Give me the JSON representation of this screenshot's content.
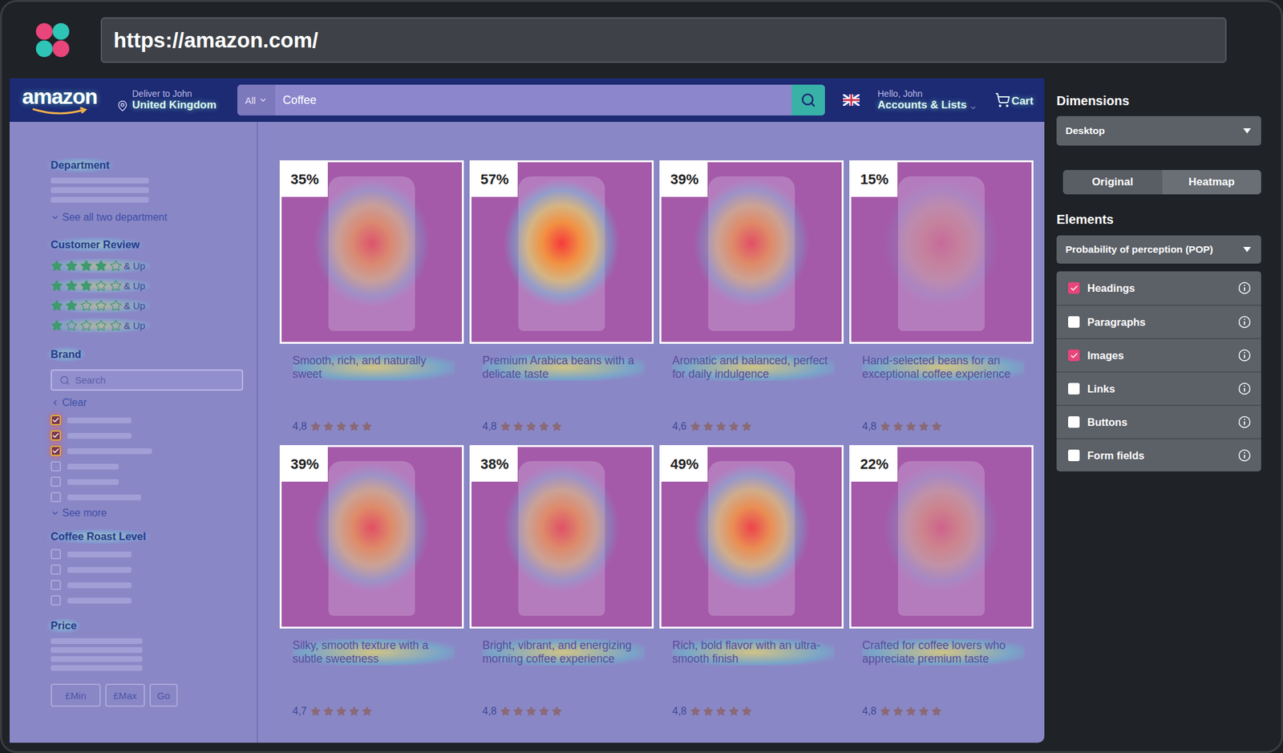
{
  "app": {
    "url": "https://amazon.com/"
  },
  "store": {
    "logo": "amazon",
    "deliver_label": "Deliver to John",
    "deliver_location": "United Kingdom",
    "search_category": "All",
    "search_value": "Coffee",
    "greeting": "Hello, John",
    "account": "Accounts & Lists",
    "cart": "Cart"
  },
  "filters": {
    "department_title": "Department",
    "see_all": "See all two department",
    "review_title": "Customer Review",
    "reviews": [
      {
        "stars": 4,
        "label": "& Up"
      },
      {
        "stars": 3,
        "label": "& Up"
      },
      {
        "stars": 2,
        "label": "& Up"
      },
      {
        "stars": 1,
        "label": "& Up"
      }
    ],
    "brand_title": "Brand",
    "brand_search_placeholder": "Search",
    "clear": "Clear",
    "brand_items": [
      {
        "checked": true
      },
      {
        "checked": true
      },
      {
        "checked": true
      },
      {
        "checked": false
      },
      {
        "checked": false
      },
      {
        "checked": false
      }
    ],
    "see_more": "See more",
    "roast_title": "Coffee Roast Level",
    "roast_items": [
      {
        "checked": false
      },
      {
        "checked": false
      },
      {
        "checked": false
      },
      {
        "checked": false
      }
    ],
    "price_title": "Price",
    "min": "£Min",
    "max": "£Max",
    "go": "Go"
  },
  "products": [
    {
      "pop": "35%",
      "description": "Smooth, rich, and naturally sweet",
      "rating": "4,8",
      "stars": 5
    },
    {
      "pop": "57%",
      "description": "Premium Arabica beans with a delicate taste",
      "rating": "4,8",
      "stars": 5
    },
    {
      "pop": "39%",
      "description": "Aromatic and balanced, perfect for daily indulgence",
      "rating": "4,6",
      "stars": 5
    },
    {
      "pop": "15%",
      "description": "Hand-selected beans for an exceptional coffee experience",
      "rating": "4,8",
      "stars": 5
    },
    {
      "pop": "39%",
      "description": "Silky, smooth texture with a subtle sweetness",
      "rating": "4,7",
      "stars": 5
    },
    {
      "pop": "38%",
      "description": "Bright, vibrant, and energizing morning coffee experience",
      "rating": "4,8",
      "stars": 5
    },
    {
      "pop": "49%",
      "description": "Rich, bold flavor with an ultra-smooth finish",
      "rating": "4,8",
      "stars": 5
    },
    {
      "pop": "22%",
      "description": "Crafted for coffee lovers who appreciate premium taste",
      "rating": "4,8",
      "stars": 5
    }
  ],
  "panel": {
    "dimensions_title": "Dimensions",
    "dimension": "Desktop",
    "views": [
      {
        "label": "Original",
        "selected": false
      },
      {
        "label": "Heatmap",
        "selected": true
      }
    ],
    "elements_title": "Elements",
    "metric": "Probability of perception (POP)",
    "elements": [
      {
        "label": "Headings",
        "checked": true
      },
      {
        "label": "Paragraphs",
        "checked": false
      },
      {
        "label": "Images",
        "checked": true
      },
      {
        "label": "Links",
        "checked": false
      },
      {
        "label": "Buttons",
        "checked": false
      },
      {
        "label": "Form fields",
        "checked": false
      }
    ]
  }
}
